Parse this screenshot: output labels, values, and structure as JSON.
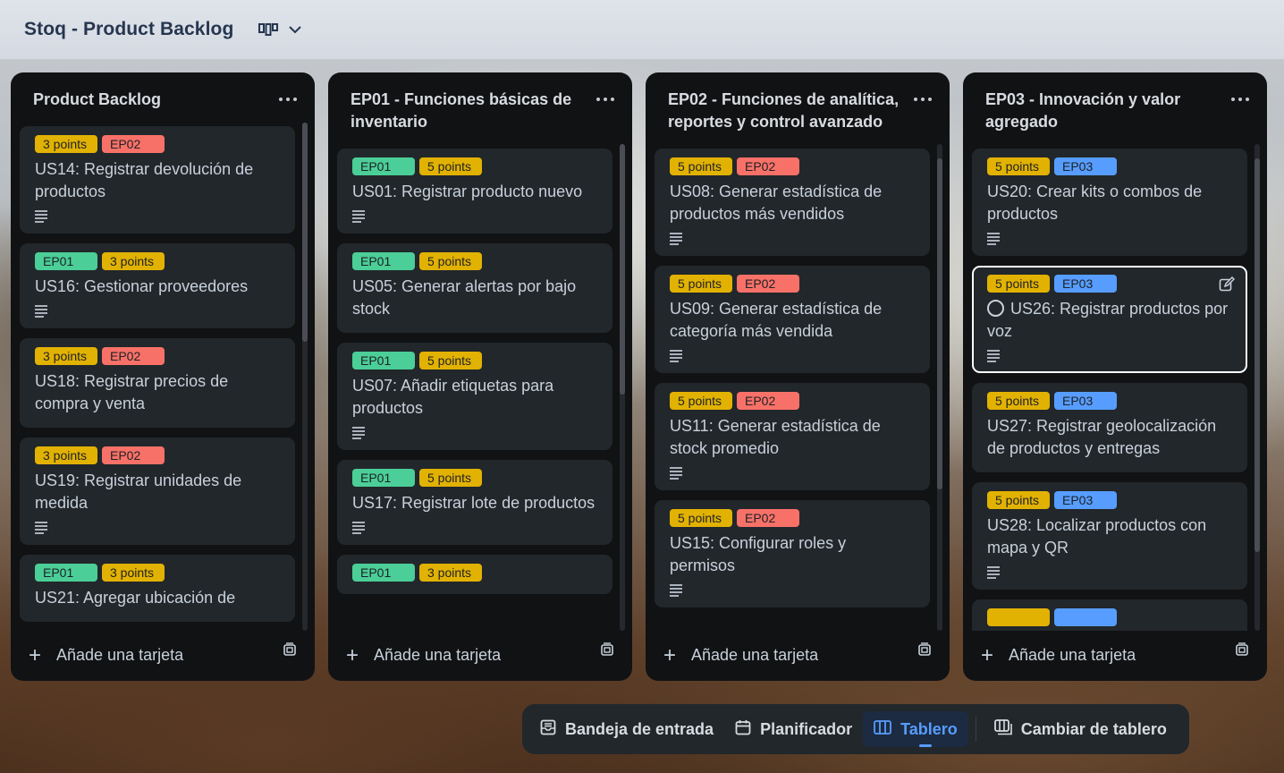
{
  "board": {
    "title": "Stoq - Product Backlog",
    "view_icon": "board-view-icon",
    "dropdown_icon": "chevron-down-icon"
  },
  "lists": [
    {
      "title": "Product Backlog",
      "cards": [
        {
          "labels": [
            {
              "text": "3 points",
              "type": "pts"
            },
            {
              "text": "EP02",
              "type": "ep02"
            }
          ],
          "title": "US14: Registrar devolución de productos"
        },
        {
          "labels": [
            {
              "text": "EP01",
              "type": "ep01"
            },
            {
              "text": "3 points",
              "type": "pts"
            }
          ],
          "title": "US16: Gestionar proveedores"
        },
        {
          "labels": [
            {
              "text": "3 points",
              "type": "pts"
            },
            {
              "text": "EP02",
              "type": "ep02"
            }
          ],
          "title": "US18: Registrar precios de compra y venta"
        },
        {
          "labels": [
            {
              "text": "3 points",
              "type": "pts"
            },
            {
              "text": "EP02",
              "type": "ep02"
            }
          ],
          "title": "US19: Registrar unidades de medida"
        },
        {
          "labels": [
            {
              "text": "EP01",
              "type": "ep01"
            },
            {
              "text": "3 points",
              "type": "pts"
            }
          ],
          "title": "US21: Agregar ubicación de"
        }
      ]
    },
    {
      "title": "EP01 - Funciones básicas de inventario",
      "cards": [
        {
          "labels": [
            {
              "text": "EP01",
              "type": "ep01"
            },
            {
              "text": "5 points",
              "type": "pts"
            }
          ],
          "title": "US01: Registrar producto nuevo"
        },
        {
          "labels": [
            {
              "text": "EP01",
              "type": "ep01"
            },
            {
              "text": "5 points",
              "type": "pts"
            }
          ],
          "title": "US05: Generar alertas por bajo stock"
        },
        {
          "labels": [
            {
              "text": "EP01",
              "type": "ep01"
            },
            {
              "text": "5 points",
              "type": "pts"
            }
          ],
          "title": "US07: Añadir etiquetas para productos"
        },
        {
          "labels": [
            {
              "text": "EP01",
              "type": "ep01"
            },
            {
              "text": "5 points",
              "type": "pts"
            }
          ],
          "title": "US17: Registrar lote de productos"
        },
        {
          "labels": [
            {
              "text": "EP01",
              "type": "ep01"
            },
            {
              "text": "3 points",
              "type": "pts"
            }
          ],
          "title": ""
        }
      ]
    },
    {
      "title": "EP02 - Funciones de analítica, reportes y control avanzado",
      "cards": [
        {
          "labels": [
            {
              "text": "5 points",
              "type": "pts"
            },
            {
              "text": "EP02",
              "type": "ep02"
            }
          ],
          "title": "US08: Generar estadística de productos más vendidos"
        },
        {
          "labels": [
            {
              "text": "5 points",
              "type": "pts"
            },
            {
              "text": "EP02",
              "type": "ep02"
            }
          ],
          "title": "US09: Generar estadística de categoría más vendida"
        },
        {
          "labels": [
            {
              "text": "5 points",
              "type": "pts"
            },
            {
              "text": "EP02",
              "type": "ep02"
            }
          ],
          "title": "US11: Generar estadística de stock promedio"
        },
        {
          "labels": [
            {
              "text": "5 points",
              "type": "pts"
            },
            {
              "text": "EP02",
              "type": "ep02"
            }
          ],
          "title": "US15: Configurar roles y permisos"
        }
      ]
    },
    {
      "title": "EP03 - Innovación y valor agregado",
      "cards": [
        {
          "labels": [
            {
              "text": "5 points",
              "type": "pts"
            },
            {
              "text": "EP03",
              "type": "ep03"
            }
          ],
          "title": "US20: Crear kits o combos de productos"
        },
        {
          "labels": [
            {
              "text": "5 points",
              "type": "pts"
            },
            {
              "text": "EP03",
              "type": "ep03"
            }
          ],
          "title": "US26: Registrar productos por voz",
          "selected": true
        },
        {
          "labels": [
            {
              "text": "5 points",
              "type": "pts"
            },
            {
              "text": "EP03",
              "type": "ep03"
            }
          ],
          "title": "US27: Registrar geolocalización de productos y entregas"
        },
        {
          "labels": [
            {
              "text": "5 points",
              "type": "pts"
            },
            {
              "text": "EP03",
              "type": "ep03"
            }
          ],
          "title": "US28: Localizar productos con mapa y QR"
        },
        {
          "labels": [
            {
              "text": "",
              "type": "pts"
            },
            {
              "text": "",
              "type": "ep03"
            }
          ],
          "title": ""
        }
      ]
    }
  ],
  "add_card_label": "Añade una tarjeta",
  "nav": {
    "inbox": "Bandeja de entrada",
    "planner": "Planificador",
    "board": "Tablero",
    "switch": "Cambiar de tablero"
  },
  "colors": {
    "ep01": "#4bce97",
    "ep02": "#f87168",
    "ep03": "#579dff",
    "points": "#e2b203",
    "active": "#579dff"
  }
}
